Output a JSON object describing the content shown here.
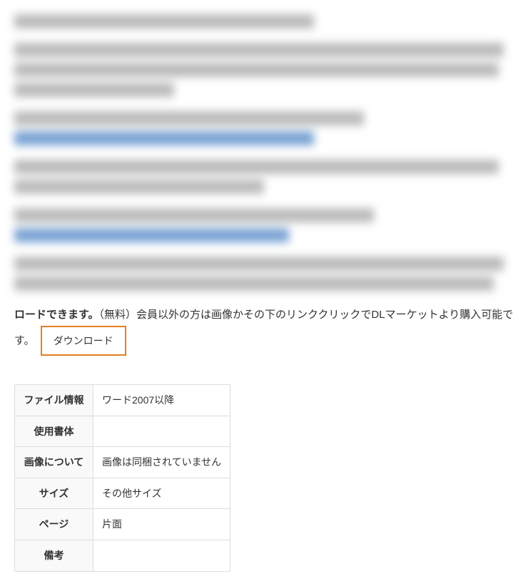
{
  "visible_paragraph": {
    "bold_prefix": "ロードできます。",
    "rest": "（無料）会員以外の方は画像かその下のリンククリックでDLマーケットより購入可能です。"
  },
  "download_button": "ダウンロード",
  "table": {
    "rows": [
      {
        "header": "ファイル情報",
        "value": "ワード2007以降"
      },
      {
        "header": "使用書体",
        "value": ""
      },
      {
        "header": "画像について",
        "value": "画像は同梱されていません"
      },
      {
        "header": "サイズ",
        "value": "その他サイズ"
      },
      {
        "header": "ページ",
        "value": "片面"
      },
      {
        "header": "備考",
        "value": ""
      }
    ]
  }
}
